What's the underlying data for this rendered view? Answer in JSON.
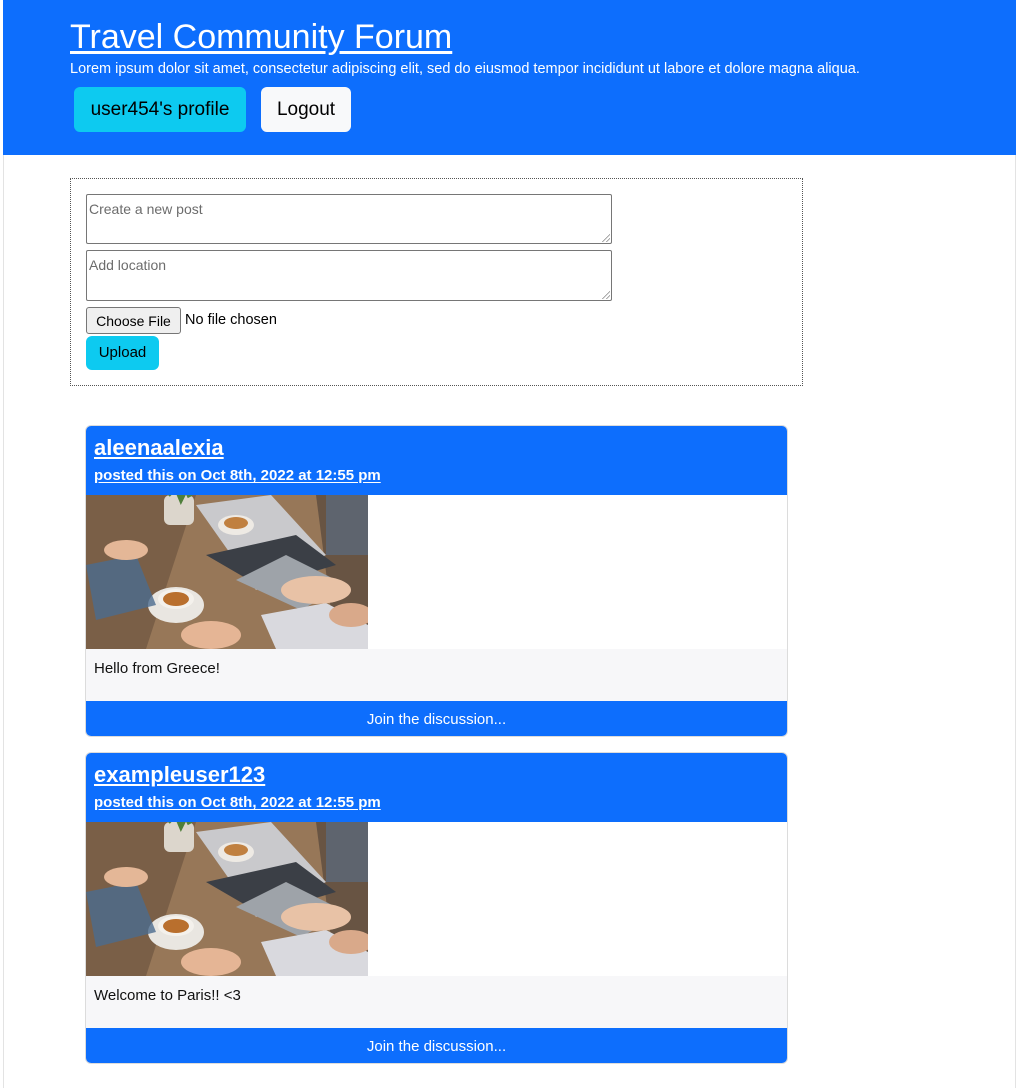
{
  "header": {
    "title": "Travel Community Forum",
    "tagline": "Lorem ipsum dolor sit amet, consectetur adipiscing elit, sed do eiusmod tempor incididunt ut labore et dolore magna aliqua.",
    "profile_button": "user454's profile",
    "logout_button": "Logout"
  },
  "composer": {
    "post_placeholder": "Create a new post",
    "location_placeholder": "Add location",
    "file_button": "Choose File",
    "file_status": "No file chosen",
    "upload_button": "Upload"
  },
  "posts": [
    {
      "username": "aleenaalexia",
      "posted": "posted this on Oct 8th, 2022 at 12:55 pm",
      "caption": "Hello from Greece!",
      "join_label": "Join the discussion..."
    },
    {
      "username": "exampleuser123",
      "posted": "posted this on Oct 8th, 2022 at 12:55 pm",
      "caption": "Welcome to Paris!! <3",
      "join_label": "Join the discussion..."
    }
  ],
  "colors": {
    "primary": "#0d6efd",
    "info": "#0dcaf0",
    "light": "#f8f9fa"
  }
}
